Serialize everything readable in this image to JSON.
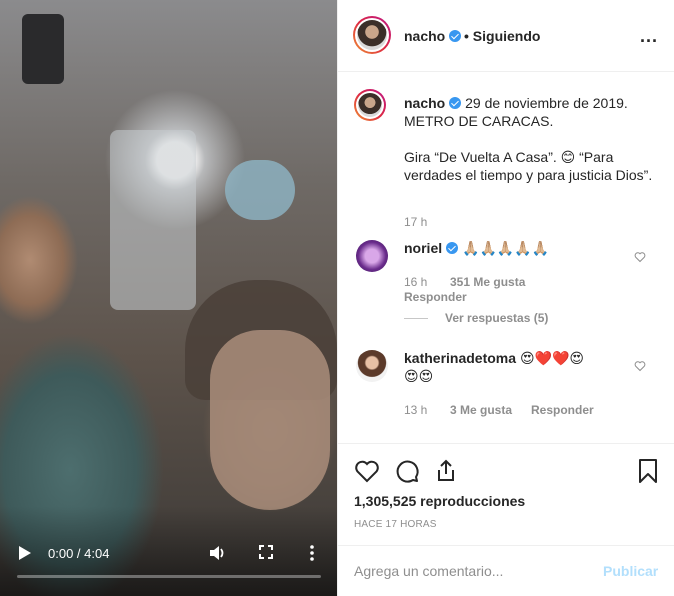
{
  "video": {
    "time": "0:00 / 4:04",
    "progress_fraction": 0.0,
    "controls": {
      "play_icon": "play-icon",
      "volume_icon": "volume-icon",
      "fullscreen_icon": "fullscreen-icon",
      "more_icon": "more-vertical-icon"
    }
  },
  "header": {
    "username": "nacho",
    "separator": "•",
    "follow_status": "Siguiendo",
    "more": "..."
  },
  "caption": {
    "username": "nacho",
    "line1": "29 de noviembre de 2019.",
    "line2": "METRO DE CARACAS.",
    "body": "Gira “De Vuelta A Casa”. 😊 “Para verdades el tiempo y para justicia Dios”.",
    "time": "17 h"
  },
  "comments": [
    {
      "username": "noriel",
      "text": "🙏🏼🙏🏼🙏🏼🙏🏼🙏🏼",
      "time": "16 h",
      "likes": "351 Me gusta",
      "reply": "Responder",
      "view_replies": "Ver respuestas (5)"
    },
    {
      "username": "katherinadetoma",
      "text": "😍❤️❤️😍",
      "text2": "😍😍",
      "time": "13 h",
      "likes": "3 Me gusta",
      "reply": "Responder"
    }
  ],
  "actions": {
    "views": "1,305,525 reproducciones",
    "ago": "HACE 17 HORAS"
  },
  "comment_box": {
    "placeholder": "Agrega un comentario...",
    "post_label": "Publicar"
  },
  "colors": {
    "verified": "#3897f0",
    "post_disabled": "#b2dffc",
    "muted": "#8e8e8e"
  }
}
